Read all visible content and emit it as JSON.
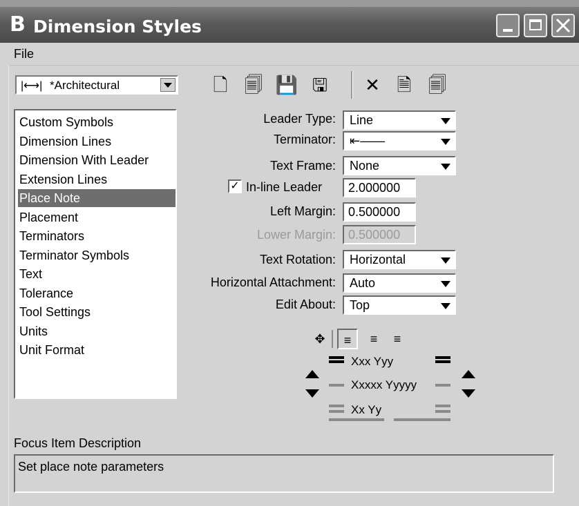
{
  "window": {
    "title": "Dimension Styles",
    "icon": "bentley-b-icon"
  },
  "menu": {
    "file_label": "File"
  },
  "style_combo": {
    "value": "*Architectural"
  },
  "toolbar": {
    "icons": [
      "new-style-icon",
      "style-properties-icon",
      "save-icon",
      "save-as-icon",
      "delete-icon",
      "reset-icon",
      "compare-icon"
    ]
  },
  "categories": [
    "Custom Symbols",
    "Dimension Lines",
    "Dimension With Leader",
    "Extension Lines",
    "Place Note",
    "Placement",
    "Terminators",
    "Terminator Symbols",
    "Text",
    "Tolerance",
    "Tool Settings",
    "Units",
    "Unit Format"
  ],
  "selected_category": "Place Note",
  "form": {
    "leader_type": {
      "label": "Leader Type:",
      "value": "Line"
    },
    "terminator": {
      "label": "Terminator:",
      "value": "⇤——"
    },
    "text_frame": {
      "label": "Text Frame:",
      "value": "None"
    },
    "inline_leader": {
      "label": "In-line Leader",
      "value": "2.000000",
      "checked": true
    },
    "left_margin": {
      "label": "Left Margin:",
      "value": "0.500000"
    },
    "lower_margin": {
      "label": "Lower Margin:",
      "value": "0.500000",
      "disabled": true
    },
    "text_rotation": {
      "label": "Text Rotation:",
      "value": "Horizontal"
    },
    "horizontal_attachment": {
      "label": "Horizontal Attachment:",
      "value": "Auto"
    },
    "edit_about": {
      "label": "Edit About:",
      "value": "Top"
    }
  },
  "preview": {
    "line1": "Xxx Yyy",
    "line2": "Xxxxx Yyyyy",
    "line3": "Xx Yy"
  },
  "focus": {
    "label": "Focus Item Description",
    "description": "Set place note parameters"
  }
}
